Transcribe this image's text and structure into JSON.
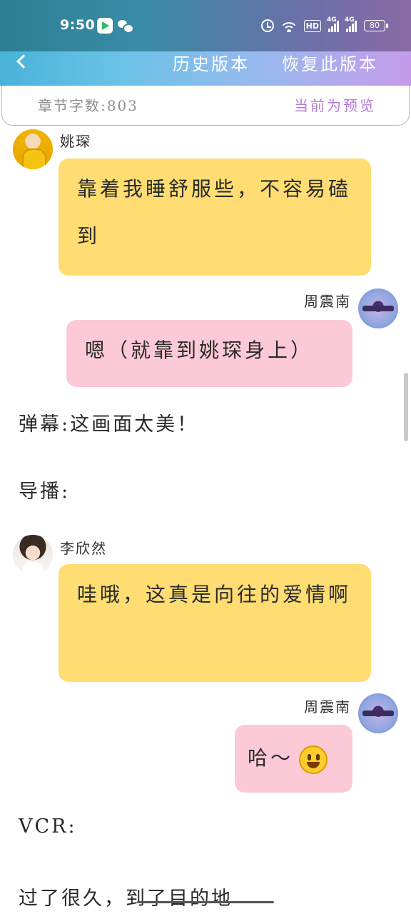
{
  "status_bar": {
    "time": "9:50",
    "network_4g_label": "4G",
    "hd_label": "HD",
    "battery": "80"
  },
  "nav": {
    "history_label": "历史版本",
    "restore_label": "恢复此版本"
  },
  "info": {
    "word_count": "章节字数:803",
    "preview_label": "当前为预览"
  },
  "messages": [
    {
      "sender": "姚琛",
      "text": "靠着我睡舒服些，不容易磕到",
      "side": "left",
      "color": "#ffdd73"
    },
    {
      "sender": "周震南",
      "text": "嗯（就靠到姚琛身上）",
      "side": "right",
      "color": "#fcc9d6"
    },
    {
      "sender": "李欣然",
      "text": "哇哦，这真是向往的爱情啊",
      "side": "left",
      "color": "#ffdd73"
    },
    {
      "sender": "周震南",
      "text": "哈～",
      "side": "right",
      "color": "#fcc9d6"
    }
  ],
  "lines": {
    "danmaku": "弹幕:这画面太美！",
    "director": "导播:",
    "vcr": "VCR:",
    "ending": "过了很久，到了目的地"
  },
  "icons": {
    "smiley": "smiley-emoji-icon"
  }
}
